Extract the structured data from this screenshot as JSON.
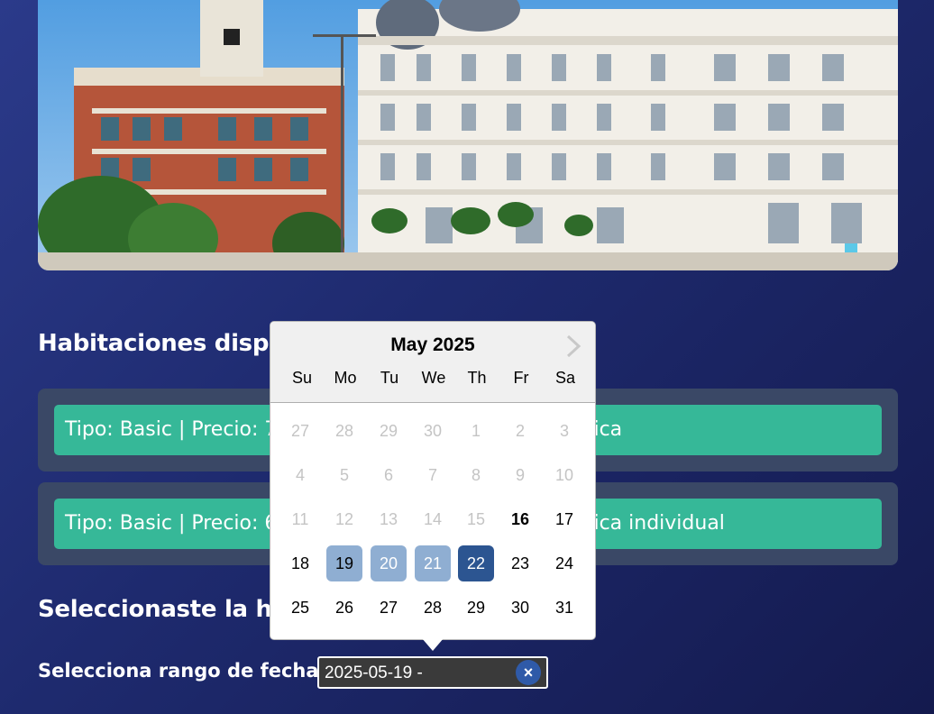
{
  "rooms_section": {
    "title": "Habitaciones disponibles"
  },
  "rooms": [
    {
      "label": "Tipo: Basic | Precio: 7",
      "suffix": "sica"
    },
    {
      "label": "Tipo: Basic | Precio: 6",
      "suffix": "sica individual"
    }
  ],
  "selected_section": {
    "title": "Seleccionaste la hab"
  },
  "date_range": {
    "label": "Selecciona rango de fechas:",
    "value": "2025-05-19 - ",
    "clear_label": "×"
  },
  "calendar": {
    "month_title": "May 2025",
    "next_icon": "chevron-right-icon",
    "weekdays": [
      "Su",
      "Mo",
      "Tu",
      "We",
      "Th",
      "Fr",
      "Sa"
    ],
    "weeks": [
      [
        "27",
        "28",
        "29",
        "30",
        "1",
        "2",
        "3"
      ],
      [
        "4",
        "5",
        "6",
        "7",
        "8",
        "9",
        "10"
      ],
      [
        "11",
        "12",
        "13",
        "14",
        "15",
        "16",
        "17"
      ],
      [
        "18",
        "19",
        "20",
        "21",
        "22",
        "23",
        "24"
      ],
      [
        "25",
        "26",
        "27",
        "28",
        "29",
        "30",
        "31"
      ]
    ],
    "selected_start": "19",
    "range_preview": [
      "20",
      "21"
    ],
    "hover_end": "22",
    "today": "16"
  },
  "colors": {
    "room_button": "#36b898",
    "room_card": "#3a4866",
    "selected_day": "#2c5591",
    "range_day": "#8faed2"
  }
}
